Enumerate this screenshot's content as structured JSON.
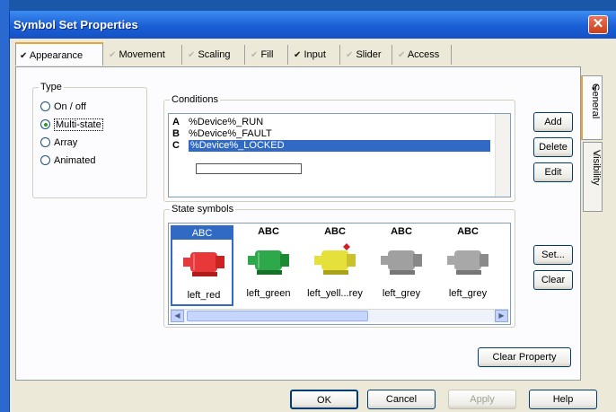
{
  "window": {
    "title": "Symbol Set Properties",
    "close_label": "✕"
  },
  "tabs": [
    {
      "label": "Appearance",
      "checked": true,
      "enabled": true,
      "active": true
    },
    {
      "label": "Movement",
      "checked": false,
      "enabled": true,
      "active": false
    },
    {
      "label": "Scaling",
      "checked": false,
      "enabled": true,
      "active": false
    },
    {
      "label": "Fill",
      "checked": false,
      "enabled": true,
      "active": false
    },
    {
      "label": "Input",
      "checked": true,
      "enabled": true,
      "active": false
    },
    {
      "label": "Slider",
      "checked": false,
      "enabled": true,
      "active": false
    },
    {
      "label": "Access",
      "checked": false,
      "enabled": true,
      "active": false
    }
  ],
  "side_tabs": [
    {
      "label": "General",
      "checked": true,
      "active": true
    },
    {
      "label": "Visibility",
      "checked": false,
      "active": false
    }
  ],
  "type_group": {
    "label": "Type",
    "options": [
      "On / off",
      "Multi-state",
      "Array",
      "Animated"
    ],
    "selected": "Multi-state"
  },
  "conditions": {
    "label": "Conditions",
    "rows": [
      {
        "letter": "A",
        "expr": "%Device%_RUN"
      },
      {
        "letter": "B",
        "expr": "%Device%_FAULT"
      },
      {
        "letter": "C",
        "expr": "%Device%_LOCKED"
      }
    ],
    "selected_index": 2,
    "buttons": {
      "add": "Add",
      "delete": "Delete",
      "edit": "Edit"
    }
  },
  "state_symbols": {
    "label": "State symbols",
    "items": [
      {
        "caption": "ABC",
        "name": "left_red",
        "color": "#e8383a"
      },
      {
        "caption": "ABC",
        "name": "left_green",
        "color": "#2da84a"
      },
      {
        "caption": "ABC",
        "name": "left_yell...rey",
        "color": "#e6e03a"
      },
      {
        "caption": "ABC",
        "name": "left_grey",
        "color": "#a0a0a0"
      },
      {
        "caption": "ABC",
        "name": "left_grey",
        "color": "#a8a8a8"
      }
    ],
    "selected_index": 0,
    "buttons": {
      "set": "Set...",
      "clear": "Clear"
    },
    "scroll_left": "◀",
    "scroll_right": "▶"
  },
  "clear_property_label": "Clear Property",
  "footer": {
    "ok": "OK",
    "cancel": "Cancel",
    "apply": "Apply",
    "help": "Help"
  },
  "colors": {
    "selection": "#316ac5",
    "tab_highlight": "#e6a53a",
    "titlebar": "#1a5fd6"
  }
}
